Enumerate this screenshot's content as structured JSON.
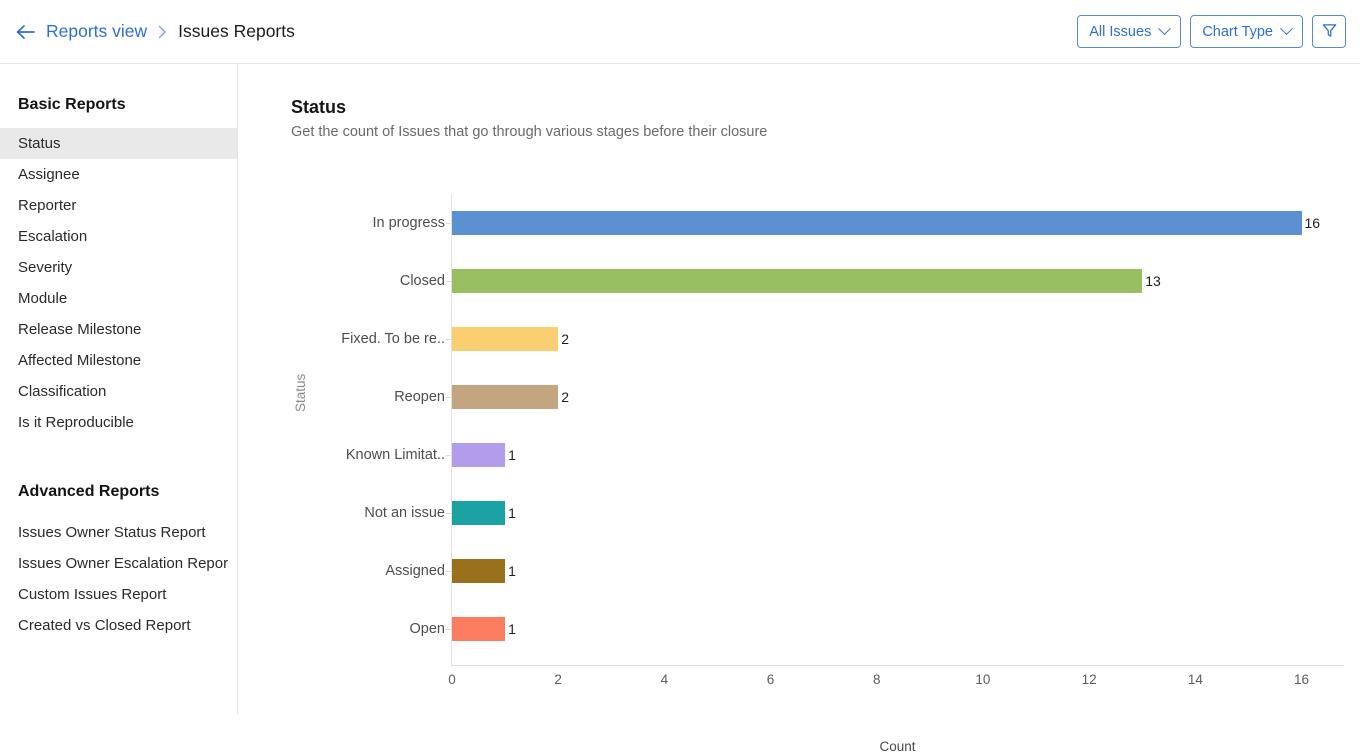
{
  "topbar": {
    "back_icon": "arrow-left-icon",
    "breadcrumb_link": "Reports view",
    "breadcrumb_sep": "›",
    "breadcrumb_current": "Issues Reports",
    "buttons": [
      {
        "label": "All Issues",
        "icon": "chevron-down-icon"
      },
      {
        "label": "Chart Type",
        "icon": "chevron-down-icon"
      }
    ],
    "filter_icon": "filter-funnel-icon"
  },
  "sidebar": {
    "basic_heading": "Basic Reports",
    "basic_items": [
      "Status",
      "Assignee",
      "Reporter",
      "Escalation",
      "Severity",
      "Module",
      "Release Milestone",
      "Affected Milestone",
      "Classification",
      "Is it Reproducible"
    ],
    "active_item": "Status",
    "advanced_heading": "Advanced Reports",
    "advanced_items": [
      "Issues Owner Status Report",
      "Issues Owner Escalation Repor",
      "Custom Issues Report",
      "Created vs Closed Report"
    ]
  },
  "main": {
    "title": "Status",
    "subtitle": "Get the count of Issues that go through various stages before their closure"
  },
  "chart_data": {
    "type": "bar",
    "orientation": "horizontal",
    "title": "Status",
    "subtitle": "Get the count of Issues that go through various stages before their closure",
    "xlabel": "Count",
    "ylabel": "Status",
    "xlim": [
      0,
      16.8
    ],
    "xticks": [
      0,
      2,
      4,
      6,
      8,
      10,
      12,
      14,
      16
    ],
    "grid": false,
    "legend": "none",
    "categories": [
      "In progress",
      "Closed",
      "Fixed. To be re..",
      "Reopen",
      "Known Limitat..",
      "Not an issue",
      "Assigned",
      "Open"
    ],
    "values": [
      16,
      13,
      2,
      2,
      1,
      1,
      1,
      1
    ],
    "value_labels": [
      "16",
      "13",
      "2",
      "2",
      "1",
      "1",
      "1",
      "1"
    ],
    "colors": [
      "#5b91d0",
      "#97bf5f",
      "#f9cf72",
      "#c3a680",
      "#b39ceb",
      "#1ba3a3",
      "#99701b",
      "#fb7c5f"
    ]
  }
}
